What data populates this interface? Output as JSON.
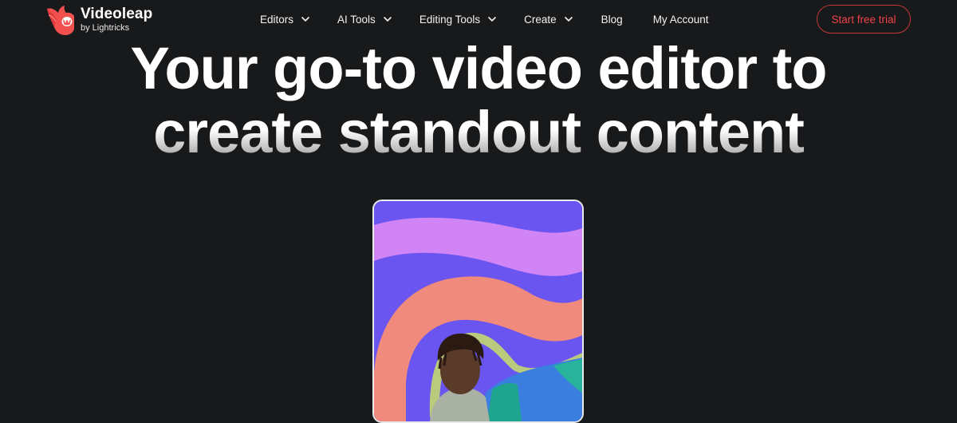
{
  "brand": {
    "name": "Videoleap",
    "subtitle": "by Lightricks",
    "logo_icon": "fox-logo-icon",
    "accent_color": "#ee4349"
  },
  "nav": {
    "items": [
      {
        "label": "Editors",
        "has_dropdown": true
      },
      {
        "label": "AI Tools",
        "has_dropdown": true
      },
      {
        "label": "Editing Tools",
        "has_dropdown": true
      },
      {
        "label": "Create",
        "has_dropdown": true
      },
      {
        "label": "Blog",
        "has_dropdown": false
      },
      {
        "label": "My Account",
        "has_dropdown": false
      }
    ],
    "cta_label": "Start free trial"
  },
  "hero": {
    "title_line1": "Your go-to video editor to",
    "title_line2": "create standout content"
  },
  "video": {
    "description": "Person in front of purple, pink and coral wavy stripes background",
    "colors": {
      "background": "#6a55f0",
      "stripe_pink": "#d184f5",
      "stripe_coral": "#f08a7c"
    }
  }
}
